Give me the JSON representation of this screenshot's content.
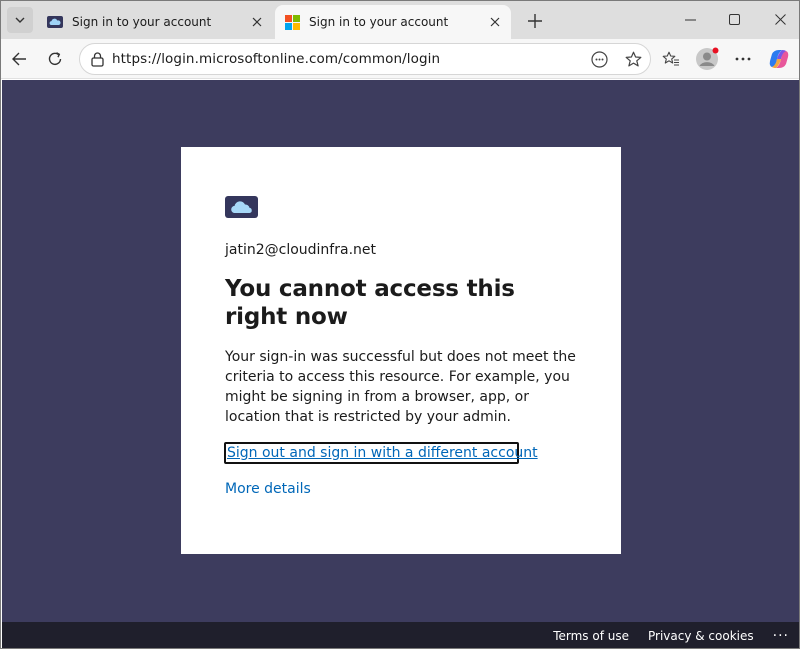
{
  "tabs": [
    {
      "title": "Sign in to your account",
      "active": false
    },
    {
      "title": "Sign in to your account",
      "active": true
    }
  ],
  "toolbar": {
    "url": "https://login.microsoftonline.com/common/login"
  },
  "card": {
    "identity": "jatin2@cloudinfra.net",
    "title": "You cannot access this right now",
    "message": "Your sign-in was successful but does not meet the criteria to access this resource. For example, you might be signing in from a browser, app, or location that is restricted by your admin.",
    "signout_link": "Sign out and sign in with a different account",
    "details_link": "More details"
  },
  "footer": {
    "terms": "Terms of use",
    "privacy": "Privacy & cookies",
    "more": "···"
  },
  "colors": {
    "page_background": "#3d3c5e",
    "link": "#0067b8",
    "footer_background": "#1f1f2c"
  },
  "icons": {
    "tab_list": "chevron-down-icon",
    "org_logo": "cloud-icon",
    "favicon_microsoft": "microsoft-logo-icon",
    "lock": "lock-icon",
    "reader": "reader-mode-icon",
    "favorite": "star-icon",
    "favorites": "favorites-list-icon",
    "profile": "profile-icon",
    "settings": "more-icon",
    "copilot": "copilot-icon"
  }
}
